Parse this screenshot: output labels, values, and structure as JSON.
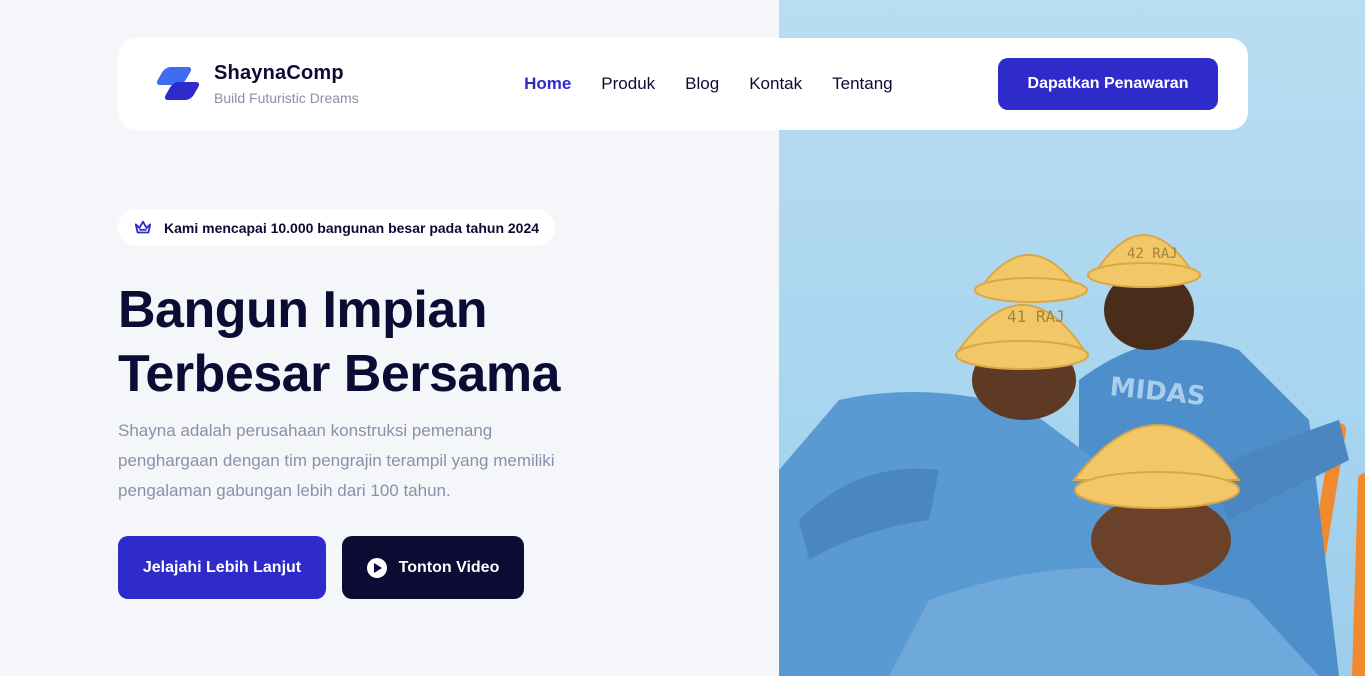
{
  "brand": {
    "name": "ShaynaComp",
    "tagline": "Build Futuristic Dreams"
  },
  "nav": {
    "items": [
      {
        "label": "Home",
        "active": true
      },
      {
        "label": "Produk",
        "active": false
      },
      {
        "label": "Blog",
        "active": false
      },
      {
        "label": "Kontak",
        "active": false
      },
      {
        "label": "Tentang",
        "active": false
      }
    ],
    "cta_label": "Dapatkan Penawaran"
  },
  "hero": {
    "badge_text": "Kami mencapai 10.000 bangunan besar pada tahun 2024",
    "badge_icon": "crown-icon",
    "headline_line1": "Bangun Impian",
    "headline_line2": "Terbesar Bersama",
    "description": "Shayna adalah perusahaan konstruksi pemenang penghargaan dengan tim pengrajin terampil yang memiliki pengalaman gabungan lebih dari 100 tahun.",
    "primary_button": "Jelajahi Lebih Lanjut",
    "secondary_button": "Tonton Video",
    "secondary_icon": "play-icon"
  },
  "photo": {
    "helmet_numbers": [
      "42 RAJ",
      "41 RAJ"
    ],
    "shirt_text": "MIDAS"
  },
  "colors": {
    "primary": "#2F2BCB",
    "dark": "#0B0B33",
    "muted": "#8A90A8",
    "background": "#F5F6FA"
  }
}
